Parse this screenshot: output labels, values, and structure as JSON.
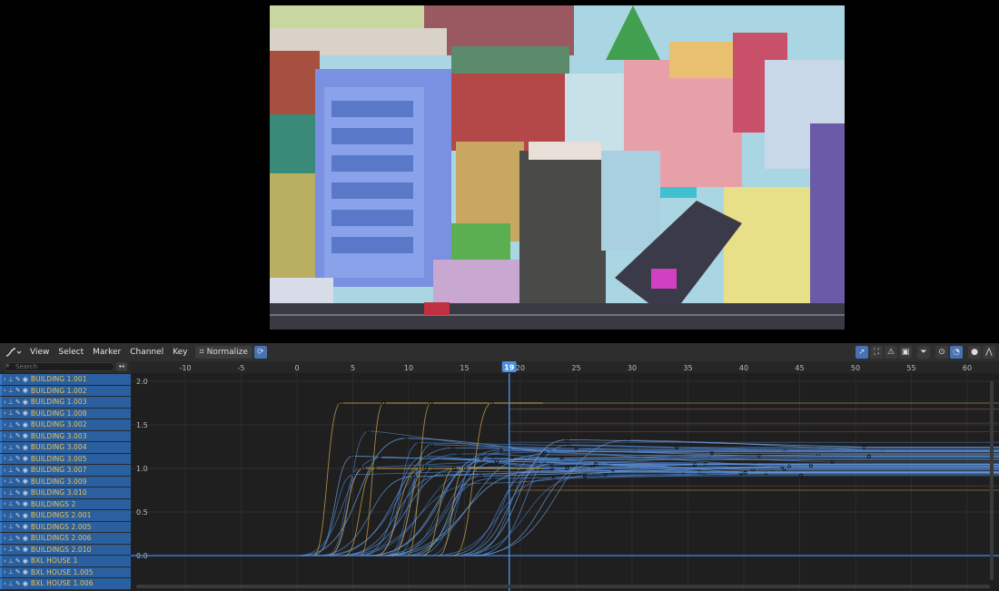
{
  "header": {
    "menus": [
      "View",
      "Select",
      "Marker",
      "Channel",
      "Key"
    ],
    "normalize_label": "Normalize"
  },
  "search": {
    "placeholder": "Search"
  },
  "timeline": {
    "current_frame": "19",
    "frame_ticks": [
      "-10",
      "-5",
      "0",
      "5",
      "10",
      "15",
      "20",
      "25",
      "30",
      "35",
      "40",
      "45",
      "50",
      "55",
      "60"
    ],
    "value_ticks": [
      "2.0",
      "1.5",
      "1.0",
      "0.5",
      "0.0"
    ]
  },
  "channels": [
    "BUILDING 1.001",
    "BUILDING 1.002",
    "BUILDING 1.003",
    "BUILDING 1.008",
    "BUILDING 3.002",
    "BUILDING 3.003",
    "BUILDING 3.004",
    "BUILDING 3.005",
    "BUILDING 3.007",
    "BUILDING 3.009",
    "BUILDING 3.010",
    "BUILDINGS 2",
    "BUILDINGS 2.001",
    "BUILDINGS 2.005",
    "BUILDINGS 2.006",
    "BUILDINGS 2.010",
    "BXL HOUSE 1",
    "BXL HOUSE 1.005",
    "BXL HOUSE 1.006"
  ],
  "colors": {
    "accent": "#4772b3",
    "channel_bg": "#2a5fa0",
    "channel_text": "#e8c25a",
    "playhead": "#4c8ee0"
  }
}
